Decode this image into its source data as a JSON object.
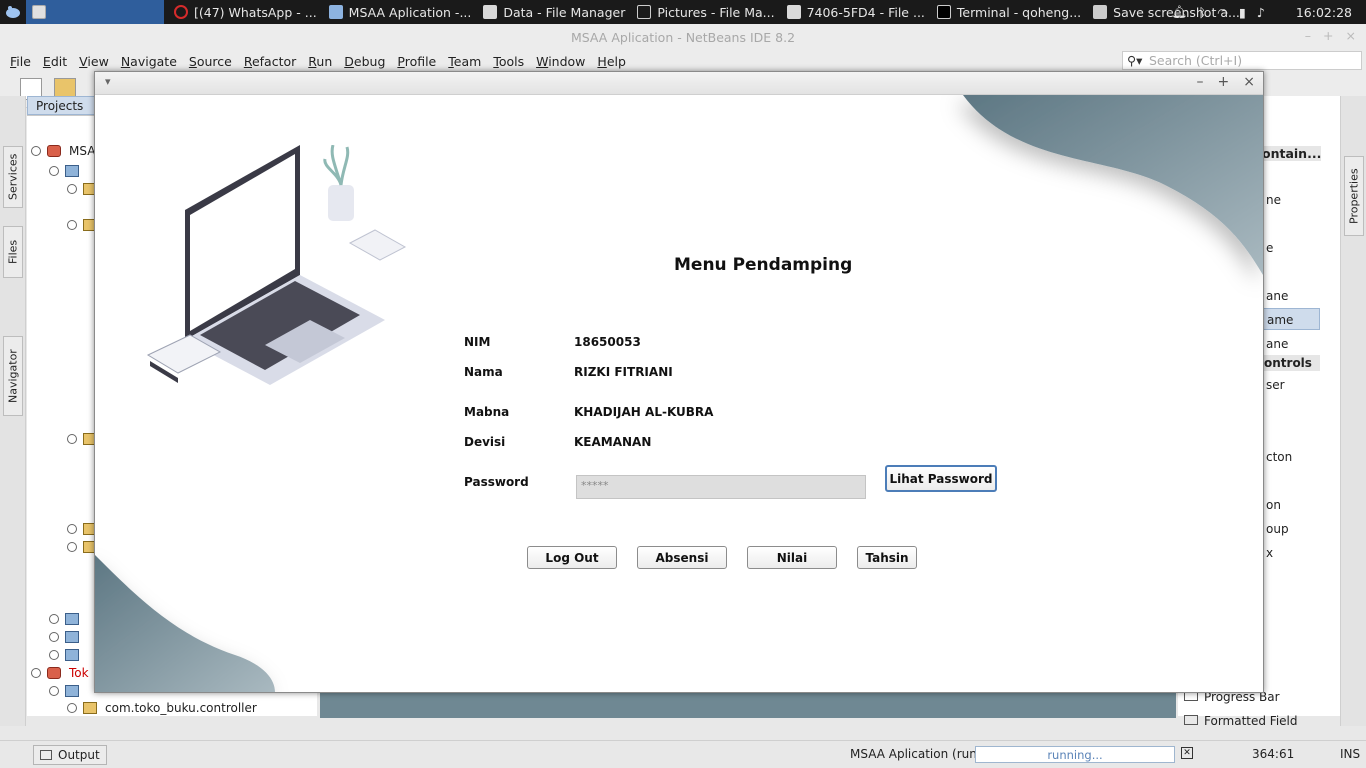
{
  "taskbar": {
    "tasks": [
      {
        "label": "[(47) WhatsApp - ..."
      },
      {
        "label": "MSAA Aplication -..."
      },
      {
        "label": "Data - File Manager"
      },
      {
        "label": "Pictures - File Ma..."
      },
      {
        "label": "7406-5FD4 - File ..."
      },
      {
        "label": "Terminal - qoheng..."
      },
      {
        "label": "Save screenshot a..."
      }
    ],
    "clock": "16:02:28"
  },
  "ide": {
    "title": "MSAA Aplication - NetBeans IDE 8.2",
    "menu": [
      "File",
      "Edit",
      "View",
      "Navigate",
      "Source",
      "Refactor",
      "Run",
      "Debug",
      "Profile",
      "Team",
      "Tools",
      "Window",
      "Help"
    ],
    "search_placeholder": "Search (Ctrl+I)",
    "side_tabs": {
      "services": "Services",
      "files": "Files",
      "navigator": "Navigator",
      "properties": "Properties"
    },
    "projects_tab": "Projects",
    "tree": {
      "msaa": "MSA",
      "toko": "Tok",
      "controller": "com.toko_buku.controller"
    },
    "palette": {
      "contain": "ontain...",
      "items_a": [
        "ne",
        "e",
        "ane",
        "ame",
        "ane"
      ],
      "controls": "ontrols",
      "items_b": [
        "ser",
        "cton",
        "on",
        "oup",
        "x"
      ],
      "progress_bar": "Progress Bar",
      "formatted_field": "Formatted Field"
    },
    "status": {
      "output": "Output",
      "run_label": "MSAA Aplication (run)",
      "progress": "running...",
      "position": "364:61",
      "mode": "INS"
    }
  },
  "app": {
    "heading": "Menu Pendamping",
    "fields": [
      {
        "label": "NIM",
        "value": "18650053"
      },
      {
        "label": "Nama",
        "value": "RIZKI FITRIANI"
      },
      {
        "label": "Mabna",
        "value": "KHADIJAH AL-KUBRA"
      },
      {
        "label": "Devisi",
        "value": "KEAMANAN"
      }
    ],
    "password_label": "Password",
    "password_value": "*****",
    "show_password_button": "Lihat Password",
    "buttons": {
      "logout": "Log Out",
      "absensi": "Absensi",
      "nilai": "Nilai",
      "tahsin": "Tahsin"
    }
  },
  "colors": {
    "accent": "#2f5e9c",
    "wave": "#6f8893",
    "button_focus": "#4c7db8"
  }
}
